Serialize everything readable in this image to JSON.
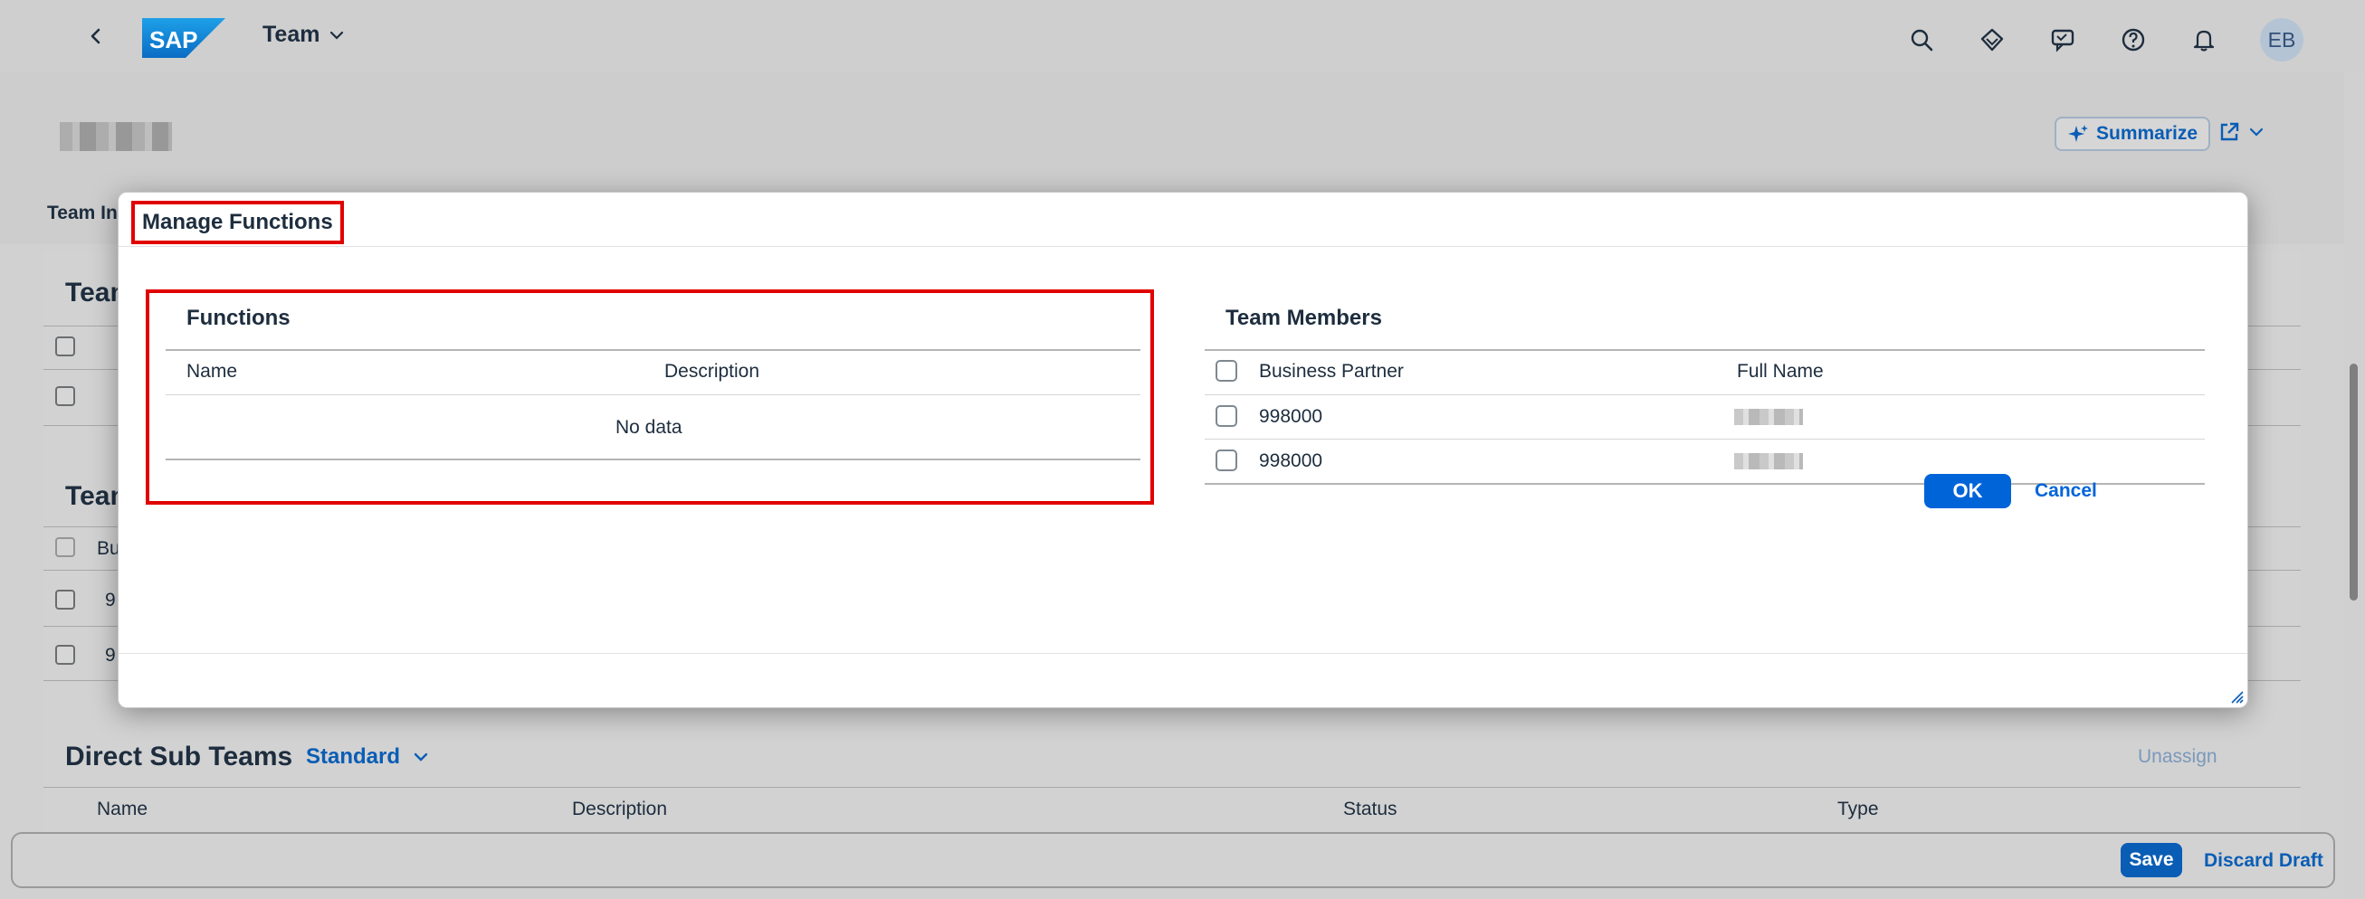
{
  "shell": {
    "logo_text": "SAP",
    "app_title": "Team",
    "avatar_initials": "EB"
  },
  "header": {
    "summarize_label": "Summarize",
    "tab_label": "Team In"
  },
  "background": {
    "section1_title": "Team",
    "section2_title": "Team",
    "section2_col_partial": "Bu",
    "row_partial_1": "9",
    "row_partial_2": "9",
    "sub_teams_title": "Direct Sub Teams",
    "variant_label": "Standard",
    "unassign_label": "Unassign",
    "sub_columns": [
      "Name",
      "Description",
      "Status",
      "Type"
    ]
  },
  "dialog": {
    "title": "Manage Functions",
    "functions": {
      "title": "Functions",
      "columns": [
        "Name",
        "Description"
      ],
      "empty_text": "No data"
    },
    "members": {
      "title": "Team Members",
      "columns": [
        "Business Partner",
        "Full Name"
      ],
      "rows": [
        {
          "partner": "998000"
        },
        {
          "partner": "998000"
        }
      ]
    },
    "ok_label": "OK",
    "cancel_label": "Cancel"
  },
  "footer": {
    "save_label": "Save",
    "discard_label": "Discard Draft"
  }
}
